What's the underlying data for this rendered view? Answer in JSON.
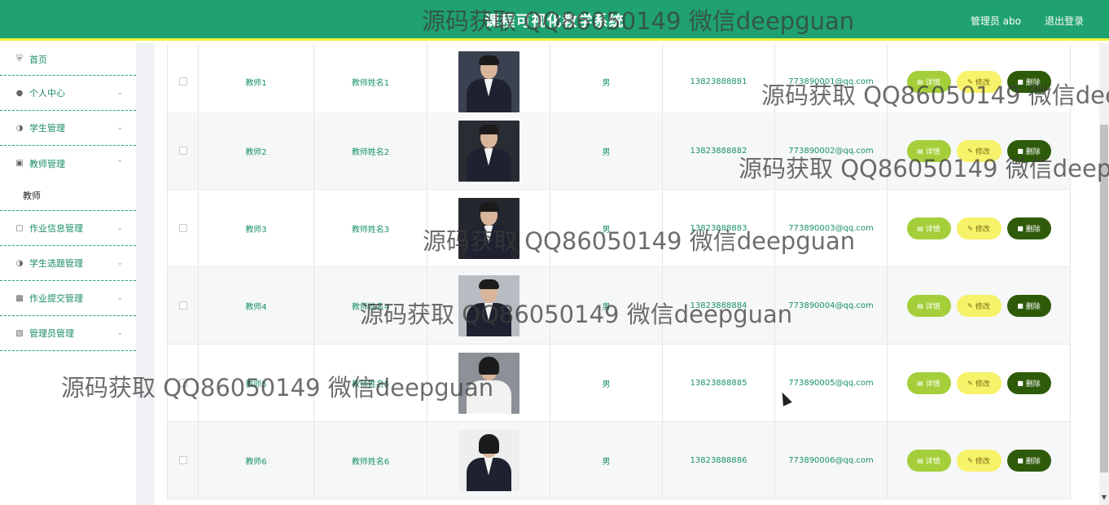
{
  "header": {
    "title": "课程可视化教学系统",
    "admin": "管理员 abo",
    "logout": "退出登录"
  },
  "sidebar": {
    "items": [
      {
        "label": "首页",
        "icon": "home-icon",
        "chevron": false
      },
      {
        "label": "个人中心",
        "icon": "user-icon",
        "chevron": true
      },
      {
        "label": "学生管理",
        "icon": "compass-icon",
        "chevron": true
      },
      {
        "label": "教师管理",
        "icon": "clipboard-icon",
        "chevron": true,
        "expanded": true
      },
      {
        "label": "作业信息管理",
        "icon": "briefcase-icon",
        "chevron": true
      },
      {
        "label": "学生选题管理",
        "icon": "compass-icon",
        "chevron": true
      },
      {
        "label": "作业提交管理",
        "icon": "desktop-icon",
        "chevron": true
      },
      {
        "label": "管理员管理",
        "icon": "wallet-icon",
        "chevron": true
      }
    ],
    "sub_items": [
      "教师"
    ]
  },
  "table": {
    "rows": [
      {
        "account": "教师1",
        "name": "教师姓名1",
        "gender": "男",
        "phone": "13823888881",
        "email": "773890001@qq.com"
      },
      {
        "account": "教师2",
        "name": "教师姓名2",
        "gender": "男",
        "phone": "13823888882",
        "email": "773890002@qq.com"
      },
      {
        "account": "教师3",
        "name": "教师姓名3",
        "gender": "男",
        "phone": "13823888883",
        "email": "773890003@qq.com"
      },
      {
        "account": "教师4",
        "name": "教师姓名4",
        "gender": "男",
        "phone": "13823888884",
        "email": "773890004@qq.com"
      },
      {
        "account": "教师5",
        "name": "教师姓名5",
        "gender": "男",
        "phone": "13823888885",
        "email": "773890005@qq.com"
      },
      {
        "account": "教师6",
        "name": "教师姓名6",
        "gender": "男",
        "phone": "13823888886",
        "email": "773890006@qq.com"
      }
    ],
    "actions": {
      "detail": "详情",
      "edit": "修改",
      "delete": "删除"
    }
  },
  "watermark": "源码获取 QQ86050149 微信deepguan",
  "colors": {
    "header": "#1fa270",
    "header_border": "#f2f23a",
    "text_green": "#1a9268",
    "detail_btn": "#a4cf3a",
    "edit_btn": "#f6f26a",
    "delete_btn": "#2e5b0a"
  }
}
